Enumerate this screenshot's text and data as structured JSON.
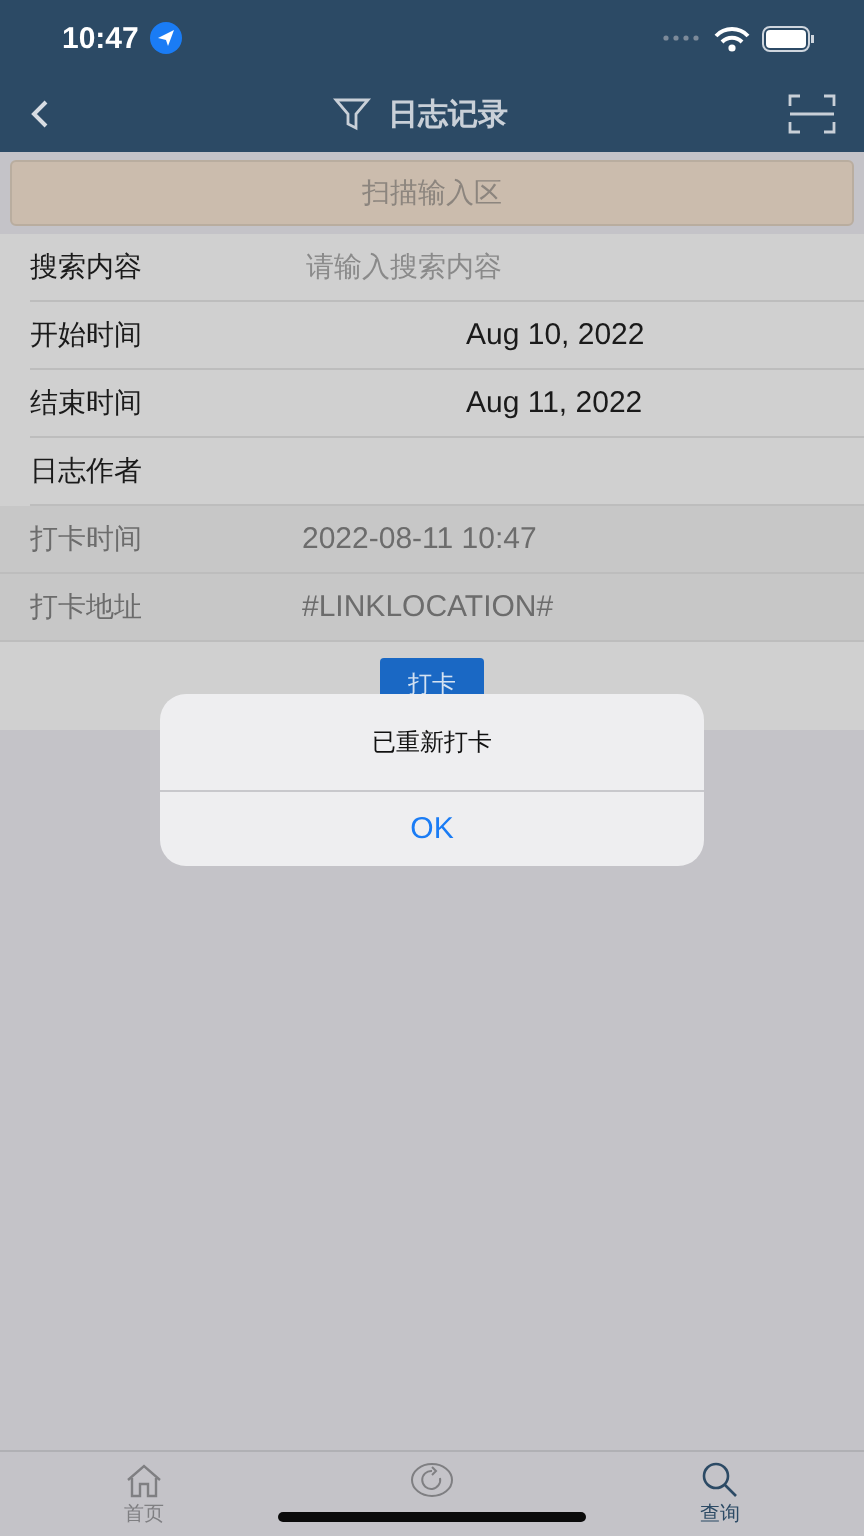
{
  "status_bar": {
    "time": "10:47"
  },
  "nav_bar": {
    "title": "日志记录"
  },
  "scan_field": {
    "placeholder": "扫描输入区"
  },
  "form_rows": [
    {
      "label": "搜索内容",
      "kind": "input",
      "placeholder": "请输入搜索内容"
    },
    {
      "label": "开始时间",
      "kind": "date",
      "value": "Aug 10, 2022"
    },
    {
      "label": "结束时间",
      "kind": "date",
      "value": "Aug 11, 2022"
    },
    {
      "label": "日志作者",
      "kind": "empty"
    },
    {
      "label": "打卡时间",
      "kind": "readonly",
      "value": "2022-08-11 10:47"
    },
    {
      "label": "打卡地址",
      "kind": "readonly",
      "value": "#LINKLOCATION#"
    }
  ],
  "check_in_button": "打卡",
  "alert": {
    "message": "已重新打卡",
    "button": "OK"
  },
  "tab_bar": [
    {
      "label": "首页",
      "kind": "home",
      "selected": false
    },
    {
      "kind": "reset",
      "selected": false
    },
    {
      "label": "查询",
      "kind": "search",
      "selected": true
    }
  ]
}
